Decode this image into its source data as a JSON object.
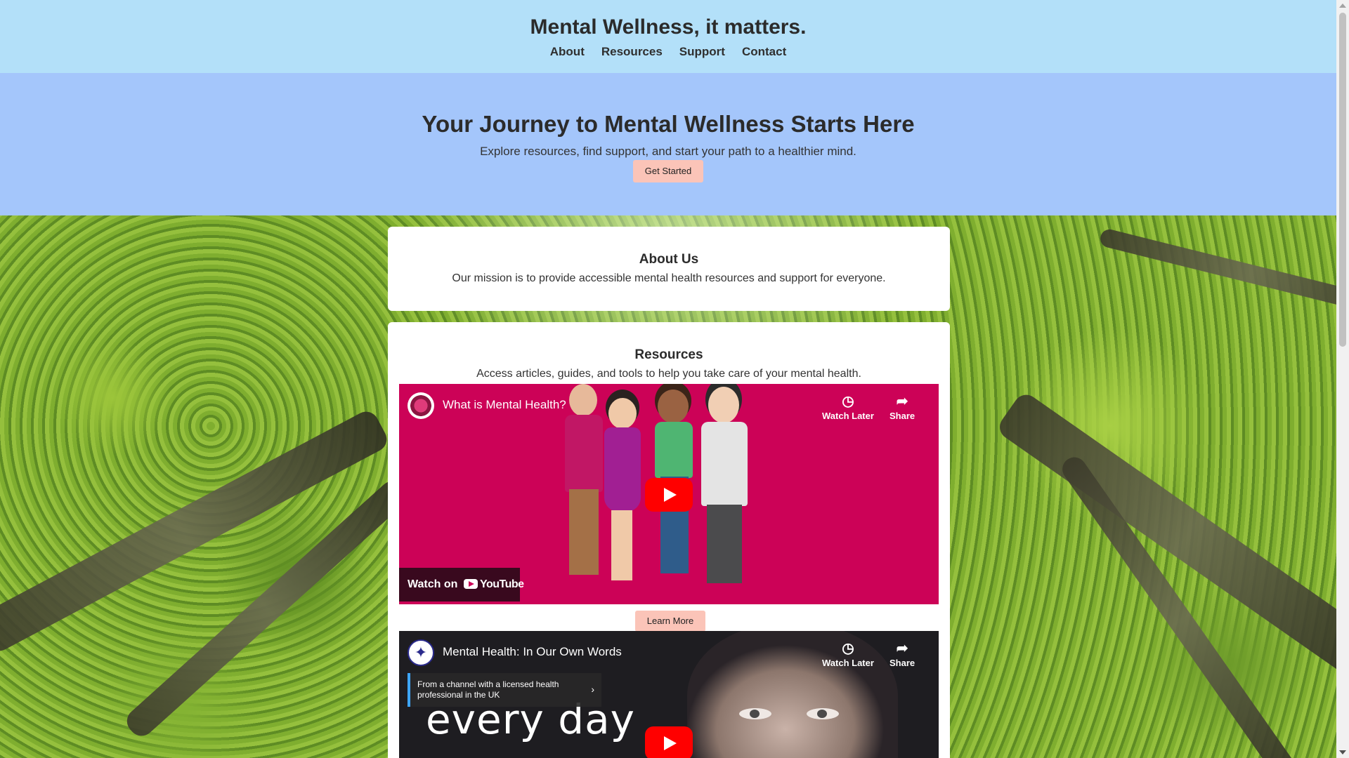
{
  "header": {
    "site_title": "Mental Wellness, it matters.",
    "nav": [
      "About",
      "Resources",
      "Support",
      "Contact"
    ]
  },
  "hero": {
    "heading": "Your Journey to Mental Wellness Starts Here",
    "subheading": "Explore resources, find support, and start your path to a healthier mind.",
    "cta_label": "Get Started"
  },
  "about": {
    "heading": "About Us",
    "text": "Our mission is to provide accessible mental health resources and support for everyone."
  },
  "resources": {
    "heading": "Resources",
    "text": "Access articles, guides, and tools to help you take care of your mental health.",
    "learn_more_label": "Learn More",
    "videos": [
      {
        "title": "What is Mental Health?",
        "watch_later": "Watch Later",
        "share": "Share",
        "watch_on": "Watch on",
        "youtube": "YouTube"
      },
      {
        "title": "Mental Health: In Our Own Words",
        "watch_later": "Watch Later",
        "share": "Share",
        "channel_note": "From a channel with a licensed health professional in the UK",
        "thumbnail_text": "every day"
      }
    ]
  },
  "colors": {
    "header_bg": "#b3e0f9",
    "hero_bg": "#a4c6fb",
    "button_bg": "#fbc4b8",
    "video1_bg": "#cc0257",
    "youtube_red": "#ff0000"
  }
}
